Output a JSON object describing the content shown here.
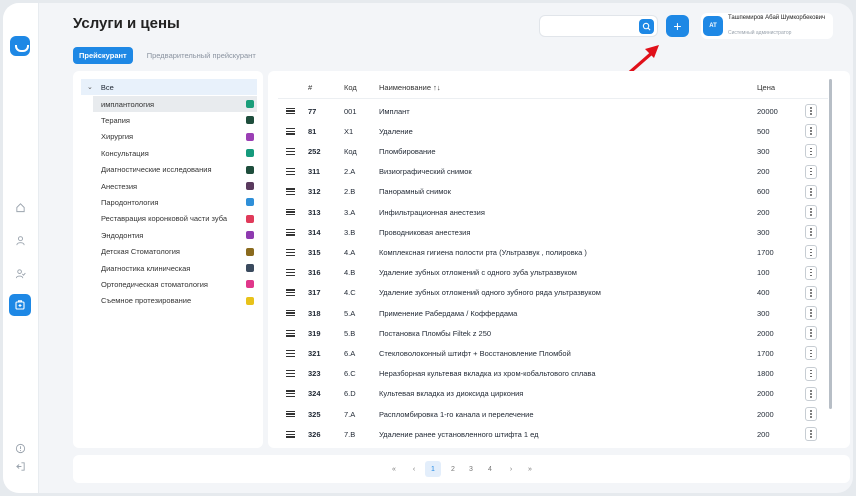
{
  "page": {
    "title": "Услуги и цены"
  },
  "tabs": [
    {
      "label": "Прейскурант",
      "active": true
    },
    {
      "label": "Предварительный прейскурант",
      "active": false
    }
  ],
  "search": {
    "value": "",
    "placeholder": ""
  },
  "user": {
    "initials": "AT",
    "name": "Ташпемиров Абай Шумкорбекович",
    "role": "Системный администратор"
  },
  "categories": {
    "all_label": "Все",
    "items": [
      {
        "label": "имплантология",
        "color": "#1a9e7a",
        "selected": true
      },
      {
        "label": "Терапия",
        "color": "#1e4d3c"
      },
      {
        "label": "Хирургия",
        "color": "#9b3fb5"
      },
      {
        "label": "Консультация",
        "color": "#159a7c"
      },
      {
        "label": "Диагностические исследования",
        "color": "#1e4d3c"
      },
      {
        "label": "Анестезия",
        "color": "#5a3a5e"
      },
      {
        "label": "Пародонтология",
        "color": "#2f8fd8"
      },
      {
        "label": "Реставрация коронковой части зуба",
        "color": "#e03a5a"
      },
      {
        "label": "Эндодонтия",
        "color": "#8e3ab0"
      },
      {
        "label": "Детская Стоматология",
        "color": "#8a6a1e"
      },
      {
        "label": "Диагностика клиническая",
        "color": "#3a4a5e"
      },
      {
        "label": "Ортопедическая стоматология",
        "color": "#e0368a"
      },
      {
        "label": "Съемное протезирование",
        "color": "#e8c21a"
      }
    ]
  },
  "table": {
    "headers": {
      "id": "#",
      "code": "Код",
      "name": "Наименование ↑↓",
      "price": "Цена"
    },
    "rows": [
      {
        "id": "77",
        "code": "001",
        "name": "Имплант",
        "price": "20000"
      },
      {
        "id": "81",
        "code": "X1",
        "name": "Удаление",
        "price": "500"
      },
      {
        "id": "252",
        "code": "Код",
        "name": "Пломбирование",
        "price": "300"
      },
      {
        "id": "311",
        "code": "2.A",
        "name": "Визиографический снимок",
        "price": "200"
      },
      {
        "id": "312",
        "code": "2.B",
        "name": "Панорамный снимок",
        "price": "600"
      },
      {
        "id": "313",
        "code": "3.A",
        "name": "Инфильтрационная анестезия",
        "price": "200"
      },
      {
        "id": "314",
        "code": "3.B",
        "name": "Проводниковая анестезия",
        "price": "300"
      },
      {
        "id": "315",
        "code": "4.A",
        "name": "Комплексная гигиена полости рта (Ультразвук , полировка )",
        "price": "1700"
      },
      {
        "id": "316",
        "code": "4.B",
        "name": "Удаление зубных отложений с одного зуба ультразвуком",
        "price": "100"
      },
      {
        "id": "317",
        "code": "4.C",
        "name": "Удаление зубных отложений одного зубного ряда ультразвуком",
        "price": "400"
      },
      {
        "id": "318",
        "code": "5.A",
        "name": "Применение Рабердама / Коффердама",
        "price": "300"
      },
      {
        "id": "319",
        "code": "5.B",
        "name": "Постановка Пломбы Filtek z 250",
        "price": "2000"
      },
      {
        "id": "321",
        "code": "6.A",
        "name": "Стекловолоконный штифт + Восстановление Пломбой",
        "price": "1700"
      },
      {
        "id": "323",
        "code": "6.C",
        "name": "Неразборная культевая вкладка из хром-кобальтового сплава",
        "price": "1800"
      },
      {
        "id": "324",
        "code": "6.D",
        "name": "Культевая вкладка из диоксида циркония",
        "price": "2000"
      },
      {
        "id": "325",
        "code": "7.A",
        "name": "Распломбировка 1-го канала и перелечение",
        "price": "2000"
      },
      {
        "id": "326",
        "code": "7.B",
        "name": "Удаление ранее установленного штифта 1 ед",
        "price": "200"
      }
    ]
  },
  "pagination": {
    "first": "«",
    "prev": "‹",
    "pages": [
      "1",
      "2",
      "3",
      "4"
    ],
    "current": "1",
    "next": "›",
    "last": "»"
  },
  "icons": [
    "logo-icon",
    "home-icon",
    "user-icon",
    "users-icon",
    "services-icon",
    "help-icon",
    "logout-icon",
    "search-icon",
    "plus-icon",
    "menu-icon",
    "kebab-icon"
  ],
  "colors": {
    "accent": "#1e88e5",
    "arrow": "#e0101a"
  }
}
